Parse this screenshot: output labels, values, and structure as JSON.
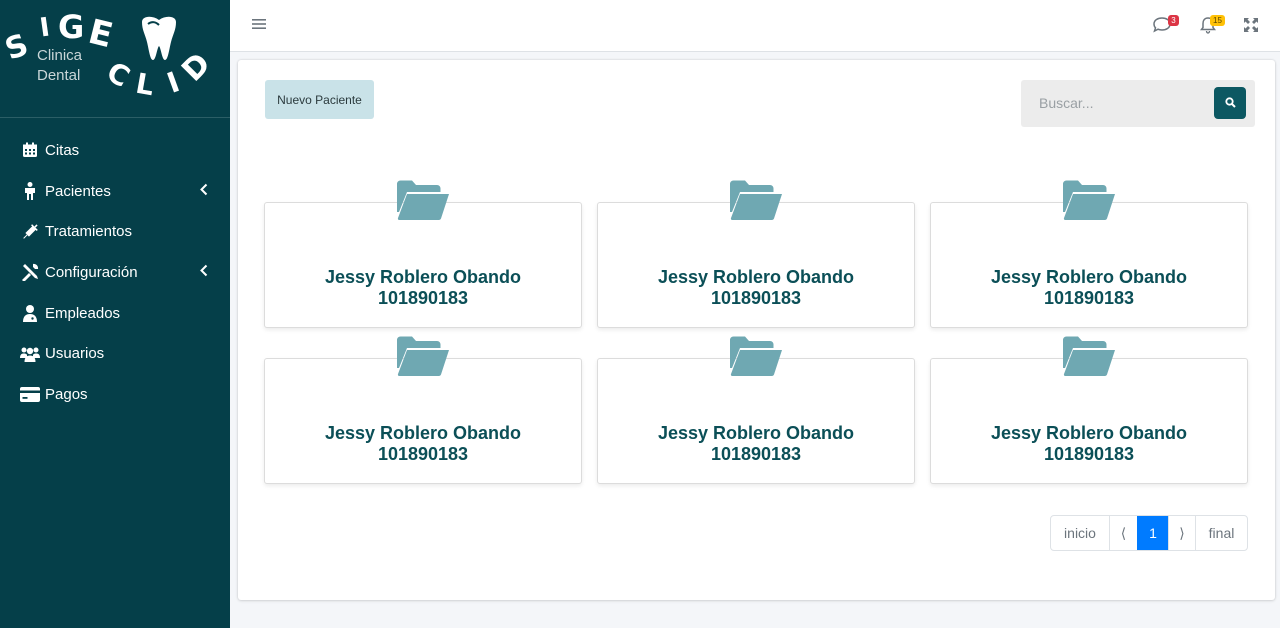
{
  "brand": {
    "logo_letters": [
      "S",
      "I",
      "G",
      "E",
      "C",
      "L",
      "I",
      "D"
    ],
    "subtitle_line1": "Clinica",
    "subtitle_line2": "Dental"
  },
  "sidebar": {
    "items": [
      {
        "label": "Citas",
        "icon": "calendar-icon",
        "has_submenu": false
      },
      {
        "label": "Pacientes",
        "icon": "person-icon",
        "has_submenu": true
      },
      {
        "label": "Tratamientos",
        "icon": "syringe-icon",
        "has_submenu": false
      },
      {
        "label": "Configuración",
        "icon": "tools-icon",
        "has_submenu": true
      },
      {
        "label": "Empleados",
        "icon": "user-doctor-icon",
        "has_submenu": false
      },
      {
        "label": "Usuarios",
        "icon": "users-icon",
        "has_submenu": false
      },
      {
        "label": "Pagos",
        "icon": "credit-card-icon",
        "has_submenu": false
      }
    ]
  },
  "topbar": {
    "messages_count": "3",
    "notifications_count": "15"
  },
  "main": {
    "new_patient_label": "Nuevo Paciente",
    "search_placeholder": "Buscar...",
    "patients": [
      {
        "name": "Jessy Roblero Obando",
        "id": "101890183"
      },
      {
        "name": "Jessy Roblero Obando",
        "id": "101890183"
      },
      {
        "name": "Jessy Roblero Obando",
        "id": "101890183"
      },
      {
        "name": "Jessy Roblero Obando",
        "id": "101890183"
      },
      {
        "name": "Jessy Roblero Obando",
        "id": "101890183"
      },
      {
        "name": "Jessy Roblero Obando",
        "id": "101890183"
      }
    ],
    "pagination": {
      "first": "inicio",
      "prev": "⟨",
      "current": "1",
      "next": "⟩",
      "last": "final"
    }
  },
  "colors": {
    "sidebar_bg": "#053f49",
    "accent": "#0c5862",
    "folder": "#6fa8b2",
    "patient_text": "#0b4f57",
    "active_page": "#007bff"
  }
}
